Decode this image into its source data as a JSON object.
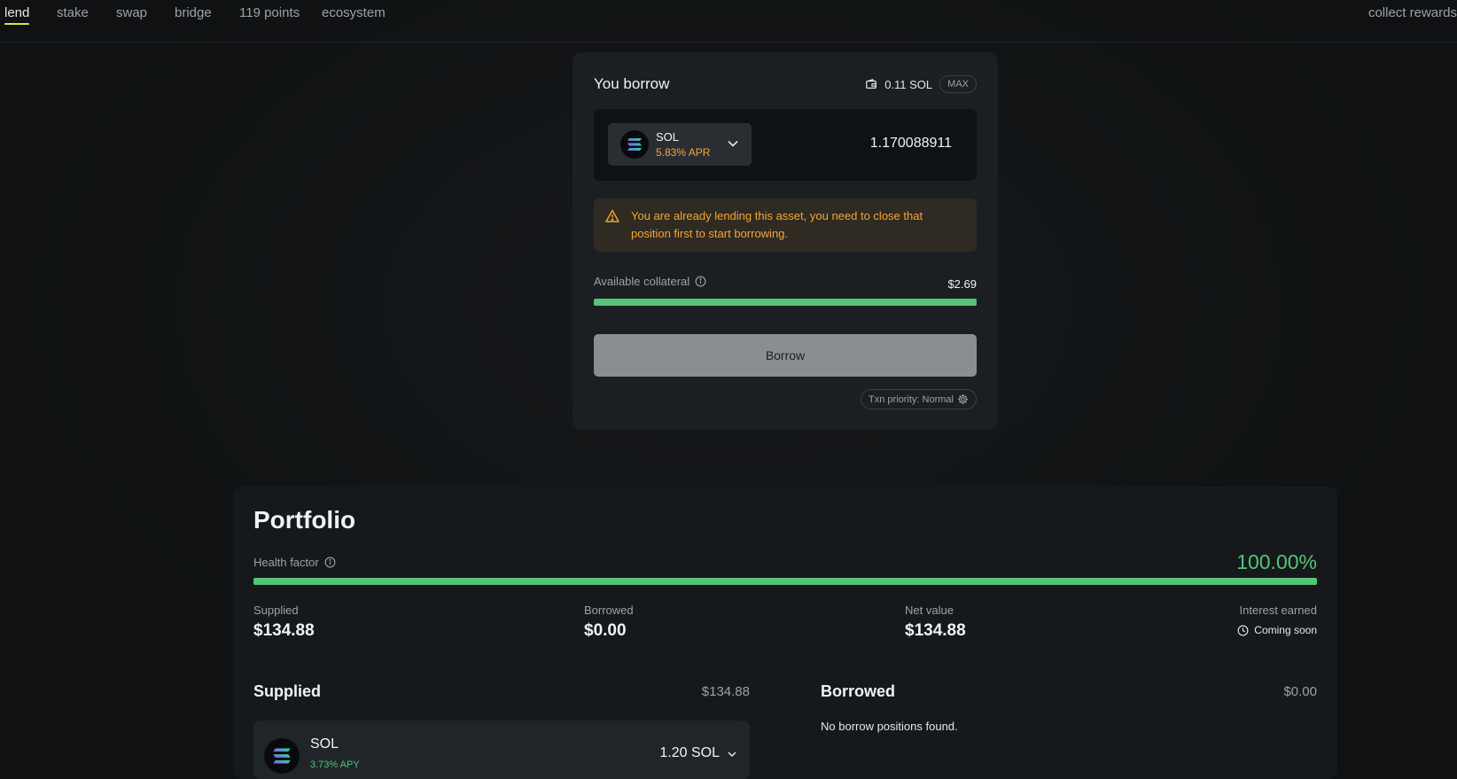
{
  "nav": {
    "items": [
      {
        "label": "lend",
        "active": true
      },
      {
        "label": "stake"
      },
      {
        "label": "swap"
      },
      {
        "label": "bridge"
      },
      {
        "label": "119 points"
      },
      {
        "label": "ecosystem"
      }
    ],
    "right_label": "collect rewards"
  },
  "borrow": {
    "title": "You borrow",
    "balance": "0.11 SOL",
    "max_label": "MAX",
    "token_symbol": "SOL",
    "token_apr": "5.83% APR",
    "amount": "1.170088911",
    "warning": "You are already lending this asset, you need to close that position first to start borrowing.",
    "collateral_label": "Available collateral",
    "collateral_value": "$2.69",
    "collateral_fill": 1.0,
    "button_label": "Borrow",
    "txn_priority": "Txn priority: Normal"
  },
  "portfolio": {
    "title": "Portfolio",
    "health_label": "Health factor",
    "health_value": "100.00%",
    "health_fill": 1.0,
    "stats": {
      "supplied_label": "Supplied",
      "supplied_value": "$134.88",
      "borrowed_label": "Borrowed",
      "borrowed_value": "$0.00",
      "net_label": "Net value",
      "net_value": "$134.88",
      "interest_label": "Interest earned",
      "interest_value": "Coming soon"
    },
    "supplied_section": {
      "title": "Supplied",
      "total": "$134.88",
      "position_symbol": "SOL",
      "position_apy": "3.73% APY",
      "position_amount": "1.20 SOL"
    },
    "borrowed_section": {
      "title": "Borrowed",
      "total": "$0.00",
      "empty": "No borrow positions found."
    }
  },
  "colors": {
    "accent_green": "#55c476",
    "warning_orange": "#f3a735",
    "nav_active_underline": "#d6e34a"
  }
}
